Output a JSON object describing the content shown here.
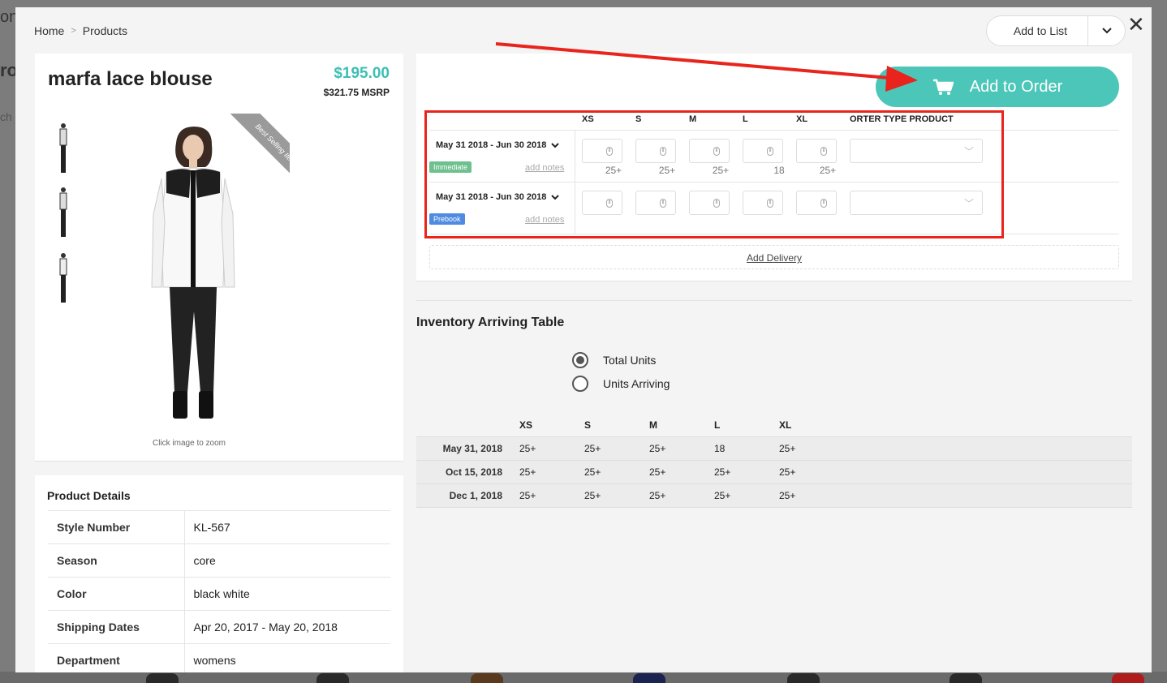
{
  "background": {
    "left_fragments": [
      "on",
      "ro",
      "ch"
    ]
  },
  "breadcrumb": {
    "home": "Home",
    "sep": ">",
    "current": "Products"
  },
  "header": {
    "add_to_list": "Add to List"
  },
  "product": {
    "title": "marfa lace blouse",
    "price": "$195.00",
    "msrp": "$321.75 MSRP",
    "ribbon": "Best Selling Item!",
    "zoom_hint": "Click image to zoom"
  },
  "details": {
    "title": "Product Details",
    "rows": [
      {
        "key": "Style Number",
        "value": "KL-567"
      },
      {
        "key": "Season",
        "value": "core"
      },
      {
        "key": "Color",
        "value": "black white"
      },
      {
        "key": "Shipping Dates",
        "value": "Apr 20, 2017 - May 20, 2018"
      },
      {
        "key": "Department",
        "value": "womens"
      }
    ]
  },
  "order": {
    "add_to_order": "Add to Order",
    "sizes": [
      "XS",
      "S",
      "M",
      "L",
      "XL"
    ],
    "type_header": "ORTER TYPE PRODUCT",
    "rows": [
      {
        "date": "May 31 2018 - Jun 30 2018",
        "badge": "Immediate",
        "notes": "add notes",
        "availability": [
          "25+",
          "25+",
          "25+",
          "18",
          "25+"
        ]
      },
      {
        "date": "May 31 2018 - Jun 30 2018",
        "badge": "Prebook",
        "notes": "add notes",
        "availability": [
          "",
          "",
          "",
          "",
          ""
        ]
      }
    ],
    "add_delivery": "Add Delivery"
  },
  "inventory": {
    "title": "Inventory Arriving Table",
    "options": [
      {
        "label": "Total Units",
        "selected": true
      },
      {
        "label": "Units Arriving",
        "selected": false
      }
    ],
    "sizes": [
      "XS",
      "S",
      "M",
      "L",
      "XL"
    ],
    "rows": [
      {
        "date": "May 31, 2018",
        "values": [
          "25+",
          "25+",
          "25+",
          "18",
          "25+"
        ]
      },
      {
        "date": "Oct 15, 2018",
        "values": [
          "25+",
          "25+",
          "25+",
          "25+",
          "25+"
        ]
      },
      {
        "date": "Dec 1, 2018",
        "values": [
          "25+",
          "25+",
          "25+",
          "25+",
          "25+"
        ]
      }
    ]
  },
  "colors": {
    "accent": "#4cc6b8",
    "annotation_red": "#e8241c",
    "immediate": "#6fc08e",
    "prebook": "#4f8be0"
  }
}
